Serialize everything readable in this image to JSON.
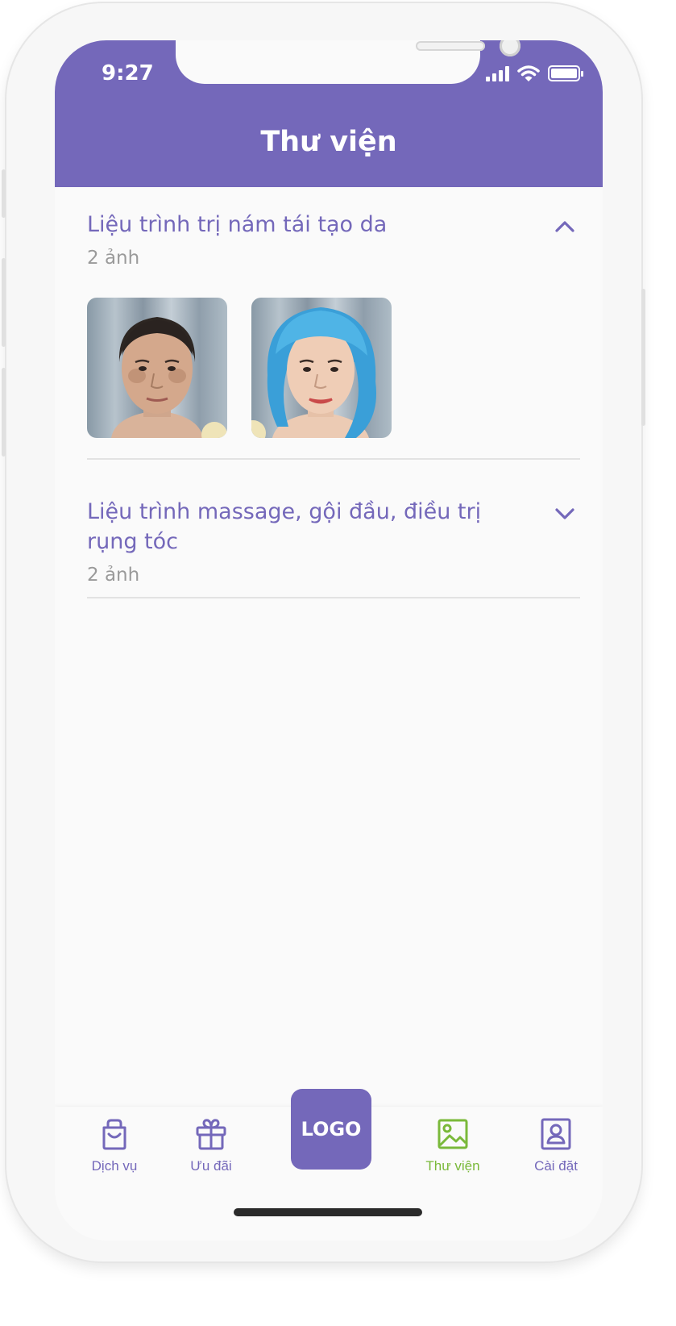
{
  "status_bar": {
    "time": "9:27"
  },
  "header": {
    "title": "Thư viện"
  },
  "sections": [
    {
      "title": "Liệu trình trị nám tái tạo da",
      "count": "2 ảnh",
      "expanded": true,
      "photos": [
        "before-photo",
        "after-photo"
      ]
    },
    {
      "title": "Liệu trình massage, gội đầu, điều trị rụng tóc",
      "count": "2 ảnh",
      "expanded": false
    }
  ],
  "tabbar": {
    "logo": "LOGO",
    "items": [
      {
        "label": "Dịch vụ",
        "icon": "shopping-bag-icon"
      },
      {
        "label": "Ưu đãi",
        "icon": "gift-icon"
      },
      {
        "label": "Thư viện",
        "icon": "image-icon",
        "active": true
      },
      {
        "label": "Cài đặt",
        "icon": "user-square-icon"
      }
    ]
  },
  "colors": {
    "brand": "#7468ba",
    "active_tab": "#7ab93a",
    "muted": "#9a9a9a"
  }
}
